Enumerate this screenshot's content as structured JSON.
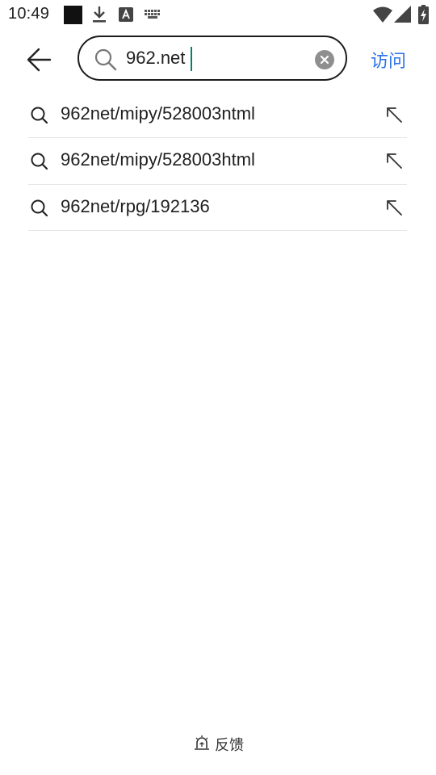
{
  "status_bar": {
    "time": "10:49",
    "icons": [
      "app-square-icon",
      "download-icon",
      "font-a-icon",
      "keyboard-icon",
      "wifi-icon",
      "cell-signal-icon",
      "battery-charging-icon"
    ]
  },
  "search": {
    "value": "962.net",
    "visit_label": "访问"
  },
  "suggestions": [
    {
      "text": "962net/mipy/528003ntml"
    },
    {
      "text": "962net/mipy/528003html"
    },
    {
      "text": "962net/rpg/192136"
    }
  ],
  "footer": {
    "feedback_label": "反馈"
  },
  "colors": {
    "accent": "#2a72e8",
    "caret": "#0a7c72",
    "text": "#1f1f1f",
    "divider": "#e6e6e6"
  }
}
